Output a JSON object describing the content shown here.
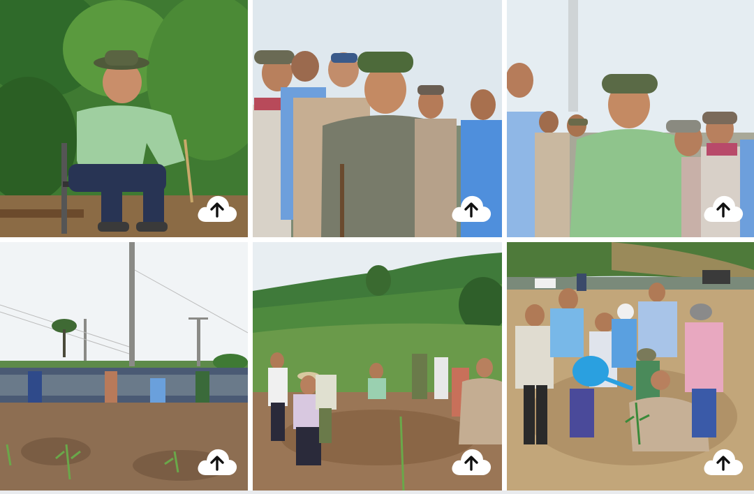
{
  "gallery": {
    "photos": [
      {
        "scene": "man-in-hat-sitting-on-chair-forest"
      },
      {
        "scene": "group-of-officials-in-hats"
      },
      {
        "scene": "officials-pointing-outdoors"
      },
      {
        "scene": "crowd-on-field-with-power-poles"
      },
      {
        "scene": "people-planting-on-hillside"
      },
      {
        "scene": "people-watering-sapling"
      }
    ],
    "upload_icon": "cloud-upload-icon",
    "colors": {
      "button_fill": "#ffffff",
      "arrow": "#111111",
      "background": "#ffffff"
    }
  }
}
